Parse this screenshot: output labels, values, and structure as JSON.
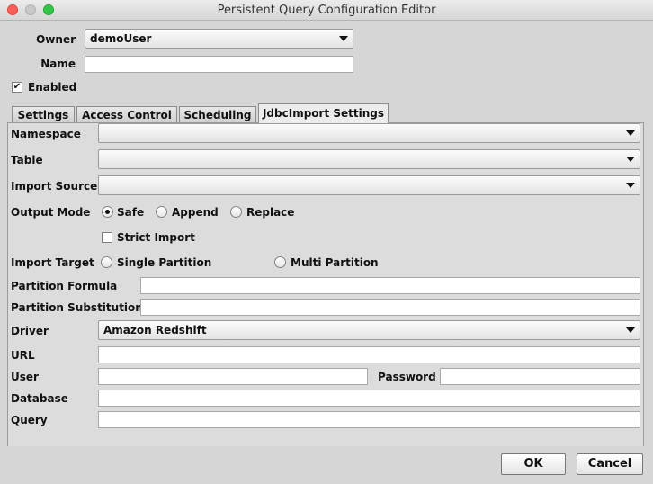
{
  "window": {
    "title": "Persistent Query Configuration Editor"
  },
  "owner": {
    "label": "Owner",
    "value": "demoUser"
  },
  "name": {
    "label": "Name",
    "value": ""
  },
  "enabled": {
    "label": "Enabled",
    "checked": true,
    "mark": "✔"
  },
  "tabs": [
    {
      "label": "Settings"
    },
    {
      "label": "Access Control"
    },
    {
      "label": "Scheduling"
    },
    {
      "label": "JdbcImport Settings",
      "active": true
    }
  ],
  "form": {
    "namespace": {
      "label": "Namespace",
      "value": ""
    },
    "table": {
      "label": "Table",
      "value": ""
    },
    "import_source": {
      "label": "Import Source",
      "value": ""
    },
    "output_mode": {
      "label": "Output Mode",
      "options": [
        "Safe",
        "Append",
        "Replace"
      ],
      "selected": "Safe"
    },
    "strict_import": {
      "label": "Strict Import",
      "checked": false
    },
    "import_target": {
      "label": "Import Target",
      "options": [
        "Single Partition",
        "Multi Partition"
      ],
      "selected": ""
    },
    "partition_formula": {
      "label": "Partition Formula",
      "value": ""
    },
    "partition_substitution": {
      "label": "Partition Substitution",
      "value": ""
    },
    "driver": {
      "label": "Driver",
      "value": "Amazon Redshift"
    },
    "url": {
      "label": "URL",
      "value": ""
    },
    "user": {
      "label": "User",
      "value": ""
    },
    "password": {
      "label": "Password",
      "value": ""
    },
    "database": {
      "label": "Database",
      "value": ""
    },
    "query": {
      "label": "Query",
      "value": ""
    }
  },
  "buttons": {
    "ok": "OK",
    "cancel": "Cancel"
  }
}
